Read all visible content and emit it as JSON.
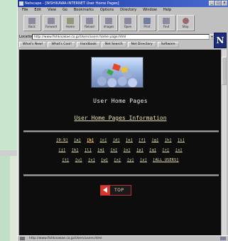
{
  "window": {
    "title": "Netscape - [NISHIKAWA-INTERNET User Home Pages]",
    "controls": [
      "_",
      "□",
      "x"
    ]
  },
  "menu": [
    "File",
    "Edit",
    "View",
    "Go",
    "Bookmarks",
    "Options",
    "Directory",
    "Window",
    "Help"
  ],
  "toolbar": [
    {
      "label": "Back",
      "icon": "back-icon"
    },
    {
      "label": "Forward",
      "icon": "forward-icon"
    },
    {
      "label": "Home",
      "icon": "home-icon"
    },
    {
      "label": "Reload",
      "icon": "reload-icon"
    },
    {
      "label": "Images",
      "icon": "images-icon"
    },
    {
      "label": "Open",
      "icon": "open-icon"
    },
    {
      "label": "Print",
      "icon": "print-icon"
    },
    {
      "label": "Find",
      "icon": "find-icon"
    },
    {
      "label": "Stop",
      "icon": "stop-icon"
    }
  ],
  "location": {
    "label": "Location:",
    "url": "http://www.fishkisakae.co.jp/Users/users home page.html"
  },
  "directory_buttons": [
    "What's New!",
    "What's Cool!",
    "Handbook",
    "Net Search",
    "Net Directory",
    "Software"
  ],
  "content": {
    "title": "User Home Pages",
    "info_link": "User Home Pages Information",
    "alphabet_rows": [
      [
        "[0-9]",
        "[a]",
        "[b]",
        "[c]",
        "[d]",
        "[e]",
        "[f]",
        "[g]",
        "[h]",
        "[i]"
      ],
      [
        "[j]",
        "[k]",
        "[l]",
        "[m]",
        "[n]",
        "[o]",
        "[p]",
        "[q]",
        "[r]",
        "[s]"
      ],
      [
        "[t]",
        "[u]",
        "[v]",
        "[w]",
        "[x]",
        "[y]",
        "[z]",
        "[ALL USERS]"
      ]
    ],
    "active_link": "[b]",
    "top_button": "TOP"
  },
  "status": {
    "text": "http://www.fishkisakae.co.jp/Users/users.html"
  },
  "colors": {
    "content_bg": "#0d0d0d",
    "link": "#e6dca8",
    "active_link": "#ffd24a",
    "top_accent": "#d7372d"
  }
}
